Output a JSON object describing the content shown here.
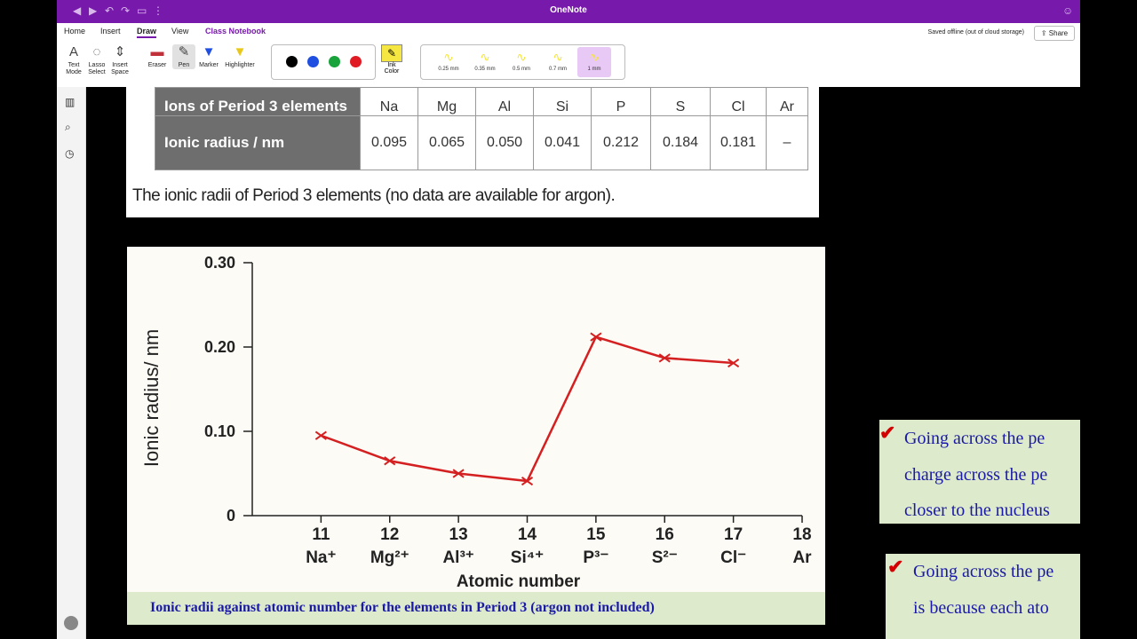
{
  "window": {
    "title": "OneNote",
    "status": "Saved offline (out of cloud storage)",
    "share_label": "Share"
  },
  "ribbon": {
    "tabs": [
      "Home",
      "Insert",
      "Draw",
      "View",
      "Class Notebook"
    ],
    "tools": [
      {
        "label1": "Text",
        "label2": "Mode"
      },
      {
        "label1": "Lasso",
        "label2": "Select"
      },
      {
        "label1": "Insert",
        "label2": "Space"
      },
      {
        "label1": "Eraser",
        "label2": ""
      },
      {
        "label1": "Pen",
        "label2": ""
      },
      {
        "label1": "Marker",
        "label2": ""
      },
      {
        "label1": "Highlighter",
        "label2": ""
      }
    ],
    "pen_colors": [
      "#000000",
      "#1f4fe0",
      "#1aa33a",
      "#e01b24"
    ],
    "ink_label1": "Ink",
    "ink_label2": "Color",
    "thickness": [
      "0.25 mm",
      "0.35 mm",
      "0.5 mm",
      "0.7 mm",
      "1 mm"
    ],
    "selected_thickness": "1 mm"
  },
  "table": {
    "row1_header": "Ions of Period 3 elements",
    "row1": [
      "Na",
      "Mg",
      "Al",
      "Si",
      "P",
      "S",
      "Cl",
      "Ar"
    ],
    "row2_header": "Ionic radius / nm",
    "row2": [
      "0.095",
      "0.065",
      "0.050",
      "0.041",
      "0.212",
      "0.184",
      "0.181",
      "–"
    ],
    "caption": "The ionic radii of Period 3 elements (no data are available for argon)."
  },
  "chart_data": {
    "type": "line",
    "x": [
      11,
      12,
      13,
      14,
      15,
      16,
      17
    ],
    "y": [
      0.095,
      0.065,
      0.05,
      0.041,
      0.212,
      0.187,
      0.181
    ],
    "x_ticks": [
      "11",
      "12",
      "13",
      "14",
      "15",
      "16",
      "17",
      "18"
    ],
    "x_ions": [
      "Na⁺",
      "Mg²⁺",
      "Al³⁺",
      "Si⁴⁺",
      "P³⁻",
      "S²⁻",
      "Cl⁻",
      "Ar"
    ],
    "y_ticks": [
      "0.30",
      "0.20",
      "0.10",
      "0"
    ],
    "xlabel": "Atomic number",
    "ylabel": "Ionic radius/ nm",
    "xlim": [
      10,
      18
    ],
    "ylim": [
      0,
      0.3
    ],
    "line_color": "#d42020",
    "caption": "Ionic radii against atomic number for the elements in Period 3 (argon not included)"
  },
  "notes": {
    "note1": [
      "Going across the pe",
      "charge across the pe",
      "closer to the nucleus"
    ],
    "note2": [
      "Going across the pe",
      "is because each ato"
    ]
  },
  "colors": {
    "brand": "#7719aa",
    "note_bg": "#ddeacb",
    "note_text": "#1a1aa6"
  }
}
